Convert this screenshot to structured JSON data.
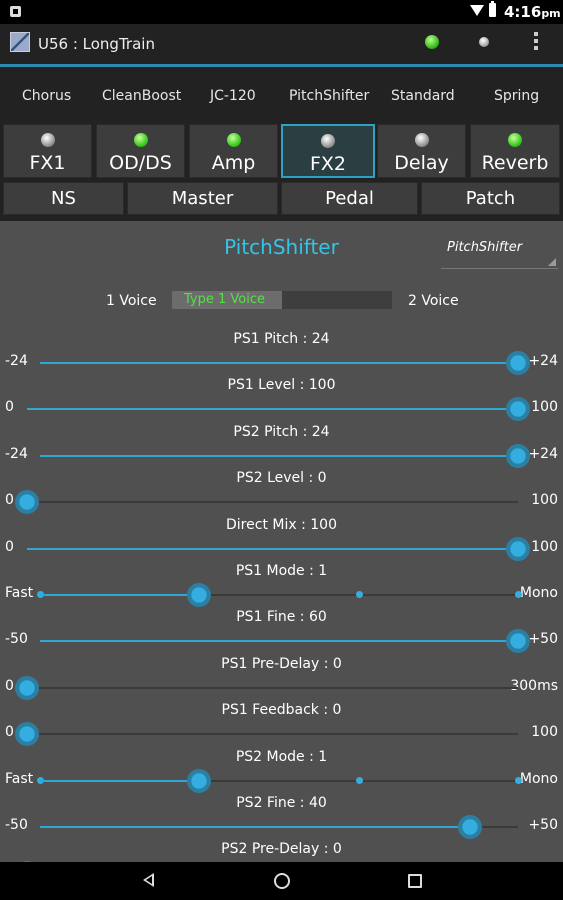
{
  "status": {
    "time": "4:16",
    "ampm": "pm"
  },
  "titlebar": {
    "title": "U56 : LongTrain"
  },
  "presets": [
    "Chorus",
    "CleanBoost",
    "JC-120",
    "PitchShifter",
    "Standard",
    "Spring"
  ],
  "fx_buttons": [
    {
      "label": "FX1",
      "led": "gray"
    },
    {
      "label": "OD/DS",
      "led": "green"
    },
    {
      "label": "Amp",
      "led": "green"
    },
    {
      "label": "FX2",
      "led": "gray",
      "selected": true
    },
    {
      "label": "Delay",
      "led": "gray"
    },
    {
      "label": "Reverb",
      "led": "green"
    }
  ],
  "sub_buttons": [
    "NS",
    "Master",
    "Pedal",
    "Patch"
  ],
  "panel": {
    "title": "PitchShifter",
    "type_select": "PitchShifter",
    "voice": {
      "left": "1 Voice",
      "right": "2 Voice",
      "current": "Type 1 Voice",
      "fraction": 0.5
    }
  },
  "params": [
    {
      "label": "PS1 Pitch : 24",
      "min": "-24",
      "max": "+24",
      "value_fraction": 1.0
    },
    {
      "label": "PS1 Level : 100",
      "min": "0",
      "max": "100",
      "value_fraction": 1.0
    },
    {
      "label": "PS2 Pitch : 24",
      "min": "-24",
      "max": "+24",
      "value_fraction": 1.0
    },
    {
      "label": "PS2 Level : 0",
      "min": "0",
      "max": "100",
      "value_fraction": 0.0
    },
    {
      "label": "Direct Mix : 100",
      "min": "0",
      "max": "100",
      "value_fraction": 1.0
    },
    {
      "label": "PS1 Mode : 1",
      "min": "Fast",
      "max": "Mono",
      "value_fraction": 0.333,
      "steps": 4
    },
    {
      "label": "PS1 Fine : 60",
      "min": "-50",
      "max": "+50",
      "value_fraction": 1.0
    },
    {
      "label": "PS1 Pre-Delay : 0",
      "min": "0",
      "max": "300ms",
      "value_fraction": 0.0
    },
    {
      "label": "PS1 Feedback : 0",
      "min": "0",
      "max": "100",
      "value_fraction": 0.0
    },
    {
      "label": "PS2 Mode : 1",
      "min": "Fast",
      "max": "Mono",
      "value_fraction": 0.333,
      "steps": 4
    },
    {
      "label": "PS2 Fine : 40",
      "min": "-50",
      "max": "+50",
      "value_fraction": 0.9
    },
    {
      "label": "PS2 Pre-Delay : 0",
      "min": "",
      "max": "",
      "value_fraction": 0.0
    }
  ]
}
